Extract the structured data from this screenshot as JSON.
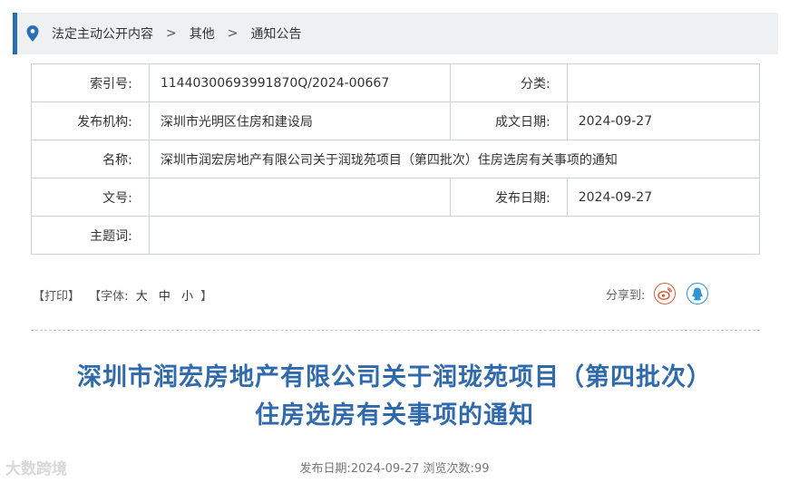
{
  "breadcrumb": {
    "items": [
      "法定主动公开内容",
      "其他",
      "通知公告"
    ],
    "separator": ">"
  },
  "meta": {
    "index_label": "索引号:",
    "index_value": "11440300693991870Q/2024-00667",
    "category_label": "分类:",
    "category_value": "",
    "org_label": "发布机构:",
    "org_value": "深圳市光明区住房和建设局",
    "created_label": "成文日期:",
    "created_value": "2024-09-27",
    "name_label": "名称:",
    "name_value": "深圳市润宏房地产有限公司关于润珑苑项目（第四批次）住房选房有关事项的通知",
    "docno_label": "文号:",
    "docno_value": "",
    "published_label": "发布日期:",
    "published_value": "2024-09-27",
    "keywords_label": "主题词:",
    "keywords_value": ""
  },
  "tools": {
    "print": "【打印】",
    "font_prefix": "【字体:",
    "font_large": "大",
    "font_medium": "中",
    "font_small": "小",
    "font_suffix": "】",
    "share_label": "分享到:",
    "share_icons": [
      "weibo-icon",
      "qq-icon"
    ]
  },
  "article": {
    "title_line1": "深圳市润宏房地产有限公司关于润珑苑项目（第四批次）",
    "title_line2": "住房选房有关事项的通知",
    "pubinfo": "发布日期:2024-09-27  浏览次数:99"
  },
  "watermark": "大数跨境",
  "colors": {
    "accent": "#2a6fb2",
    "title": "#2f6aad",
    "weibo": "#e05a3a",
    "qq": "#2a96d6"
  }
}
